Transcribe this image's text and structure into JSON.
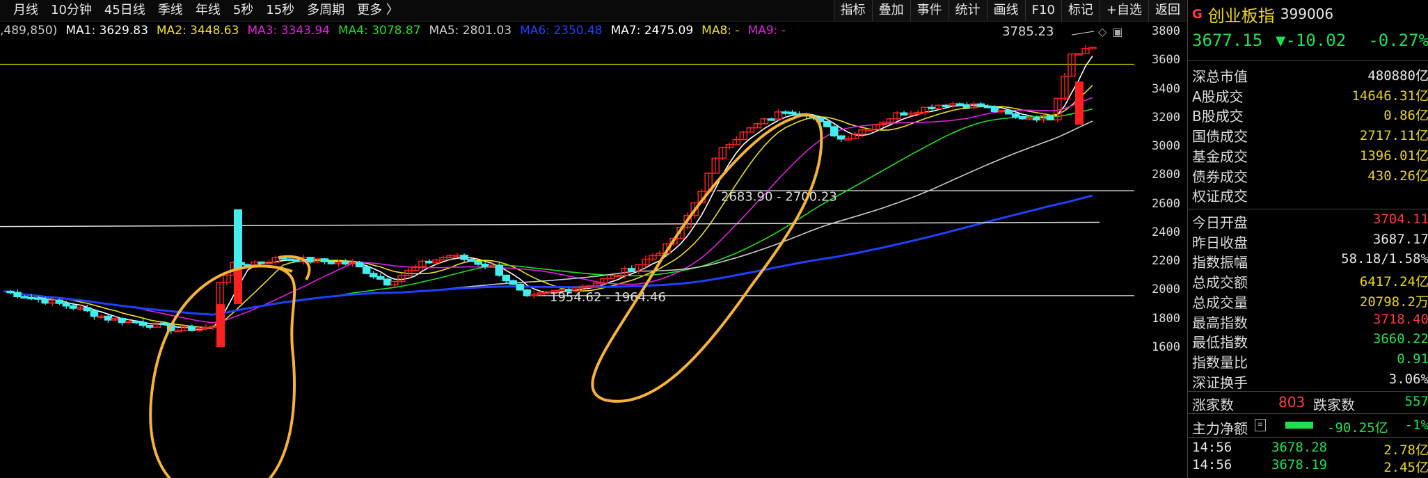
{
  "toolbar": {
    "left_items": [
      "月线",
      "10分钟",
      "45日线",
      "季线",
      "年线",
      "5秒",
      "15秒",
      "多周期",
      "更多 〉"
    ],
    "right_items": [
      "指标",
      "叠加",
      "事件",
      "统计",
      "画线",
      "F10",
      "标记",
      "+自选",
      "返回"
    ]
  },
  "ma_legend": [
    {
      "label": ",489,850)",
      "color": "#cccccc"
    },
    {
      "label": "MA1: 3629.83",
      "color": "#ffffff"
    },
    {
      "label": "MA2: 3448.63",
      "color": "#f0e020"
    },
    {
      "label": "MA3: 3343.94",
      "color": "#e020e0"
    },
    {
      "label": "MA4: 3078.87",
      "color": "#20e020"
    },
    {
      "label": "MA5: 2801.03",
      "color": "#cccccc"
    },
    {
      "label": "MA6: 2350.48",
      "color": "#2040ff"
    },
    {
      "label": "MA7: 2475.09",
      "color": "#ffffff"
    },
    {
      "label": "MA8: -",
      "color": "#f0e020"
    },
    {
      "label": "MA9: -",
      "color": "#e020e0"
    }
  ],
  "chart_data": {
    "type": "candlestick",
    "y_ticks": [
      3800,
      3600,
      3400,
      3200,
      3000,
      2800,
      2600,
      2400,
      2200,
      2000,
      1800,
      1600
    ],
    "annotations": {
      "high": "3785.23",
      "range1": "2683.90 - 2700.23",
      "range2": "1954.62 - 1964.46"
    }
  },
  "panel": {
    "market_badge": "G",
    "name": "创业板指",
    "code": "399006",
    "price": "3677.15",
    "change": "▼-10.02",
    "pct": "-0.27%",
    "stats": [
      {
        "label": "深总市值",
        "value": "480880亿",
        "color": "wht"
      },
      {
        "label": "A股成交",
        "value": "14646.31亿",
        "color": "yel"
      },
      {
        "label": "B股成交",
        "value": "0.86亿",
        "color": "yel"
      },
      {
        "label": "国债成交",
        "value": "2717.11亿",
        "color": "yel"
      },
      {
        "label": "基金成交",
        "value": "1396.01亿",
        "color": "yel"
      },
      {
        "label": "债券成交",
        "value": "430.26亿",
        "color": "yel"
      },
      {
        "label": "权证成交",
        "value": "",
        "color": "yel"
      }
    ],
    "quotes": [
      {
        "label": "今日开盘",
        "value": "3704.11",
        "color": "red"
      },
      {
        "label": "昨日收盘",
        "value": "3687.17",
        "color": "wht"
      },
      {
        "label": "指数振幅",
        "value": "58.18/1.58%",
        "color": "wht"
      },
      {
        "label": "总成交额",
        "value": "6417.24亿",
        "color": "yel"
      },
      {
        "label": "总成交量",
        "value": "20798.2万",
        "color": "yel"
      },
      {
        "label": "最高指数",
        "value": "3718.40",
        "color": "red"
      },
      {
        "label": "最低指数",
        "value": "3660.22",
        "color": "grn"
      },
      {
        "label": "指数量比",
        "value": "0.91",
        "color": "grn"
      },
      {
        "label": "深证换手",
        "value": "3.06%",
        "color": "wht"
      }
    ],
    "advance_label": "涨家数",
    "advance": "803",
    "decline_label": "跌家数",
    "decline": "557",
    "flow_label": "主力净额",
    "flow_value": "-90.25亿",
    "flow_pct": "-1%",
    "ticks": [
      {
        "time": "14:56",
        "price": "3678.28",
        "vol": "2.78亿"
      },
      {
        "time": "14:56",
        "price": "3678.19",
        "vol": "2.45亿"
      }
    ]
  }
}
